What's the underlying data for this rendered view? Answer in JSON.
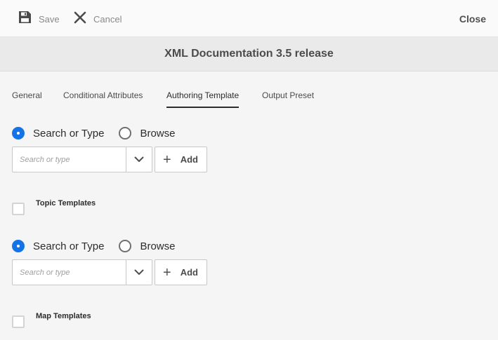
{
  "toolbar": {
    "save_label": "Save",
    "cancel_label": "Cancel",
    "close_label": "Close"
  },
  "title": "XML Documentation 3.5 release",
  "tabs": [
    {
      "label": "General",
      "active": false
    },
    {
      "label": "Conditional Attributes",
      "active": false
    },
    {
      "label": "Authoring Template",
      "active": true
    },
    {
      "label": "Output Preset",
      "active": false
    }
  ],
  "sections": [
    {
      "radio_options": [
        "Search or Type",
        "Browse"
      ],
      "selected": "Search or Type",
      "search_placeholder": "Search or type",
      "search_value": "",
      "add_label": "Add",
      "checkbox_label": "Topic Templates",
      "checkbox_checked": false
    },
    {
      "radio_options": [
        "Search or Type",
        "Browse"
      ],
      "selected": "Search or Type",
      "search_placeholder": "Search or type",
      "search_value": "",
      "add_label": "Add",
      "checkbox_label": "Map Templates",
      "checkbox_checked": false
    }
  ],
  "icons": {
    "save": "floppy-disk-icon",
    "cancel": "close-x-icon",
    "dropdown": "chevron-down-icon",
    "add": "plus-icon"
  },
  "colors": {
    "accent": "#1473e6",
    "background": "#f5f5f5",
    "title_bar": "#eaeaea"
  }
}
